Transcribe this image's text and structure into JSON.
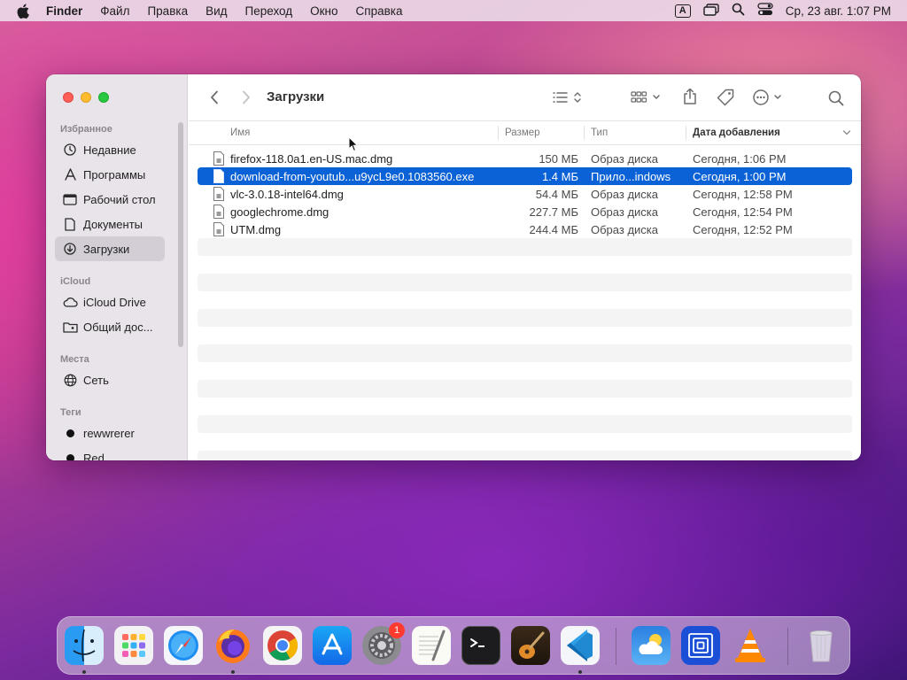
{
  "menubar": {
    "app": "Finder",
    "items": [
      "Файл",
      "Правка",
      "Вид",
      "Переход",
      "Окно",
      "Справка"
    ],
    "input_source": "A",
    "clock": "Ср, 23 авг. 1:07 PM"
  },
  "sidebar": {
    "favorites_title": "Избранное",
    "favorites": [
      {
        "label": "Недавние",
        "icon": "clock-icon"
      },
      {
        "label": "Программы",
        "icon": "applications-icon"
      },
      {
        "label": "Рабочий стол",
        "icon": "desktop-icon"
      },
      {
        "label": "Документы",
        "icon": "document-icon"
      },
      {
        "label": "Загрузки",
        "icon": "download-icon",
        "active": true
      }
    ],
    "icloud_title": "iCloud",
    "icloud": [
      {
        "label": "iCloud Drive",
        "icon": "cloud-icon"
      },
      {
        "label": "Общий дос...",
        "icon": "shared-folder-icon"
      }
    ],
    "locations_title": "Места",
    "locations": [
      {
        "label": "Сеть",
        "icon": "network-icon"
      }
    ],
    "tags_title": "Теги",
    "tags": [
      {
        "label": "rewwrerer",
        "color": "#111111"
      },
      {
        "label": "Red",
        "color": "#111111"
      }
    ]
  },
  "toolbar": {
    "title": "Загрузки"
  },
  "list": {
    "columns": {
      "name": "Имя",
      "size": "Размер",
      "kind": "Тип",
      "date": "Дата добавления"
    },
    "rows": [
      {
        "name": "firefox-118.0a1.en-US.mac.dmg",
        "size": "150 МБ",
        "kind": "Образ диска",
        "date": "Сегодня, 1:06 PM"
      },
      {
        "name": "download-from-youtub...u9ycL9e0.1083560.exe",
        "size": "1.4 МБ",
        "kind": "Прило...indows",
        "date": "Сегодня, 1:00 PM",
        "selected": true
      },
      {
        "name": "vlc-3.0.18-intel64.dmg",
        "size": "54.4 МБ",
        "kind": "Образ диска",
        "date": "Сегодня, 12:58 PM"
      },
      {
        "name": "googlechrome.dmg",
        "size": "227.7 МБ",
        "kind": "Образ диска",
        "date": "Сегодня, 12:54 PM"
      },
      {
        "name": "UTM.dmg",
        "size": "244.4 МБ",
        "kind": "Образ диска",
        "date": "Сегодня, 12:52 PM"
      }
    ]
  },
  "dock": {
    "apps": [
      "finder-icon",
      "launchpad-icon",
      "safari-icon",
      "firefox-icon",
      "chrome-icon",
      "app-store-icon",
      "system-settings-icon",
      "textedit-icon",
      "terminal-icon",
      "garageband-icon",
      "vscode-icon",
      "weather-icon",
      "utm-icon",
      "vlc-icon",
      "trash-icon"
    ],
    "settings_badge": "1"
  }
}
